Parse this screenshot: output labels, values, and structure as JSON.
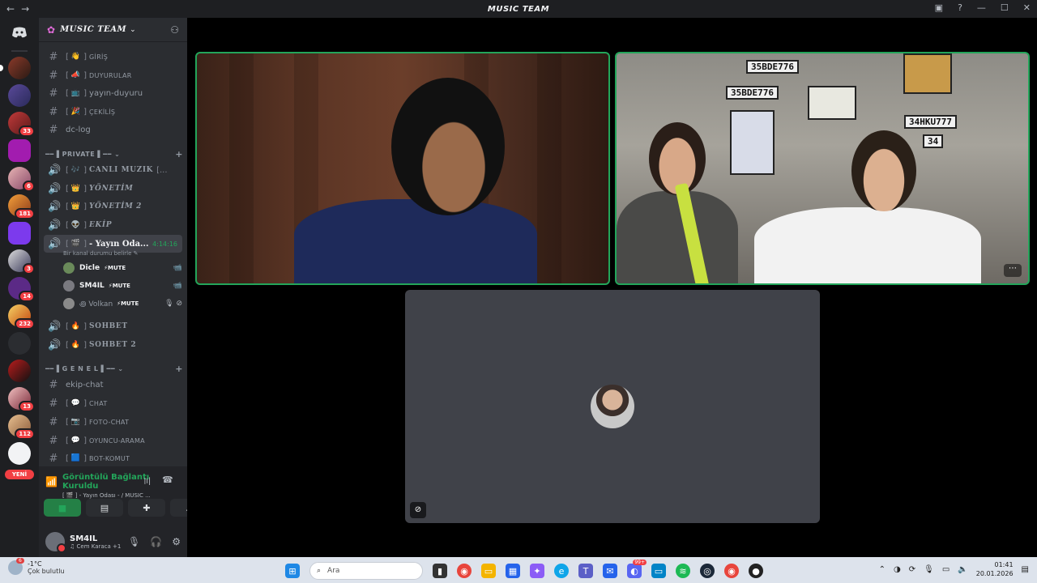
{
  "window": {
    "title": "MUSIC TEAM",
    "back": "←",
    "forward": "→"
  },
  "guild": {
    "name": "MUSIC TEAM"
  },
  "rail": {
    "badges": [
      "33",
      "6",
      "181",
      "3",
      "14",
      "232",
      "13",
      "112"
    ],
    "new_label": "YENİ"
  },
  "channels": {
    "text_top": [
      {
        "emoji": "👋",
        "name": "GİRİŞ"
      },
      {
        "emoji": "📣",
        "name": "DUYURULAR"
      },
      {
        "emoji": "📺",
        "name": "yayın-duyuru"
      },
      {
        "emoji": "🎉",
        "name": "ÇEKİLİŞ"
      },
      {
        "name": "dc-log"
      }
    ],
    "cat_private": "PRIVATE",
    "voice_private": [
      {
        "emoji": "🎶",
        "name": "CANLI MUZIK"
      },
      {
        "emoji": "👑",
        "name": "YÖNETİM"
      },
      {
        "emoji": "👑",
        "name": "YÖNETİM 2"
      },
      {
        "emoji": "👽",
        "name": "EKİP"
      }
    ],
    "active_voice": {
      "emoji": "🎬",
      "name": "- Yayın Oda...",
      "time": "4:14:16",
      "status": "Bir kanal durumu belirle"
    },
    "voice_users": [
      {
        "name": "Dicle",
        "mute": "⚡MUTE",
        "icons": "📹"
      },
      {
        "name": "SM4IL",
        "mute": "⚡MUTE",
        "icons": "📹"
      },
      {
        "name": "꩜ Volkan",
        "mute": "⚡MUTE",
        "icons": "🎙 ⊘"
      }
    ],
    "voice_more": [
      {
        "emoji": "🔥",
        "name": "SOHBET"
      },
      {
        "emoji": "🔥",
        "name": "SOHBET 2"
      }
    ],
    "cat_genel": "G E N E L",
    "text_genel": [
      {
        "name": "ekip-chat"
      },
      {
        "emoji": "💬",
        "name": "CHAT"
      },
      {
        "emoji": "📷",
        "name": "FOTO-CHAT"
      },
      {
        "emoji": "💬",
        "name": "OYUNCU-ARAMA"
      },
      {
        "emoji": "🟦",
        "name": "BOT-KOMUT"
      }
    ]
  },
  "voice_panel": {
    "status": "Görüntülü Bağlantı Kuruldu",
    "location": "[ 🎬 ] - Yayın Odası - / MUSIC ..."
  },
  "user": {
    "name": "SM4IL",
    "activity": "♫ Cem Karaca +1"
  },
  "stage": {
    "plates": [
      "35BDE776",
      "35BDE776",
      "34HKU777",
      "34"
    ]
  },
  "taskbar": {
    "weather_badge": "6",
    "temp": "-1°C",
    "condition": "Çok bulutlu",
    "search_placeholder": "Ara",
    "time": "01:41",
    "date": "20.01.2026",
    "discord_badge": "99+"
  },
  "colors": {
    "accent_green": "#23a55a",
    "danger": "#f23f43",
    "sidebar": "#2b2d31"
  }
}
